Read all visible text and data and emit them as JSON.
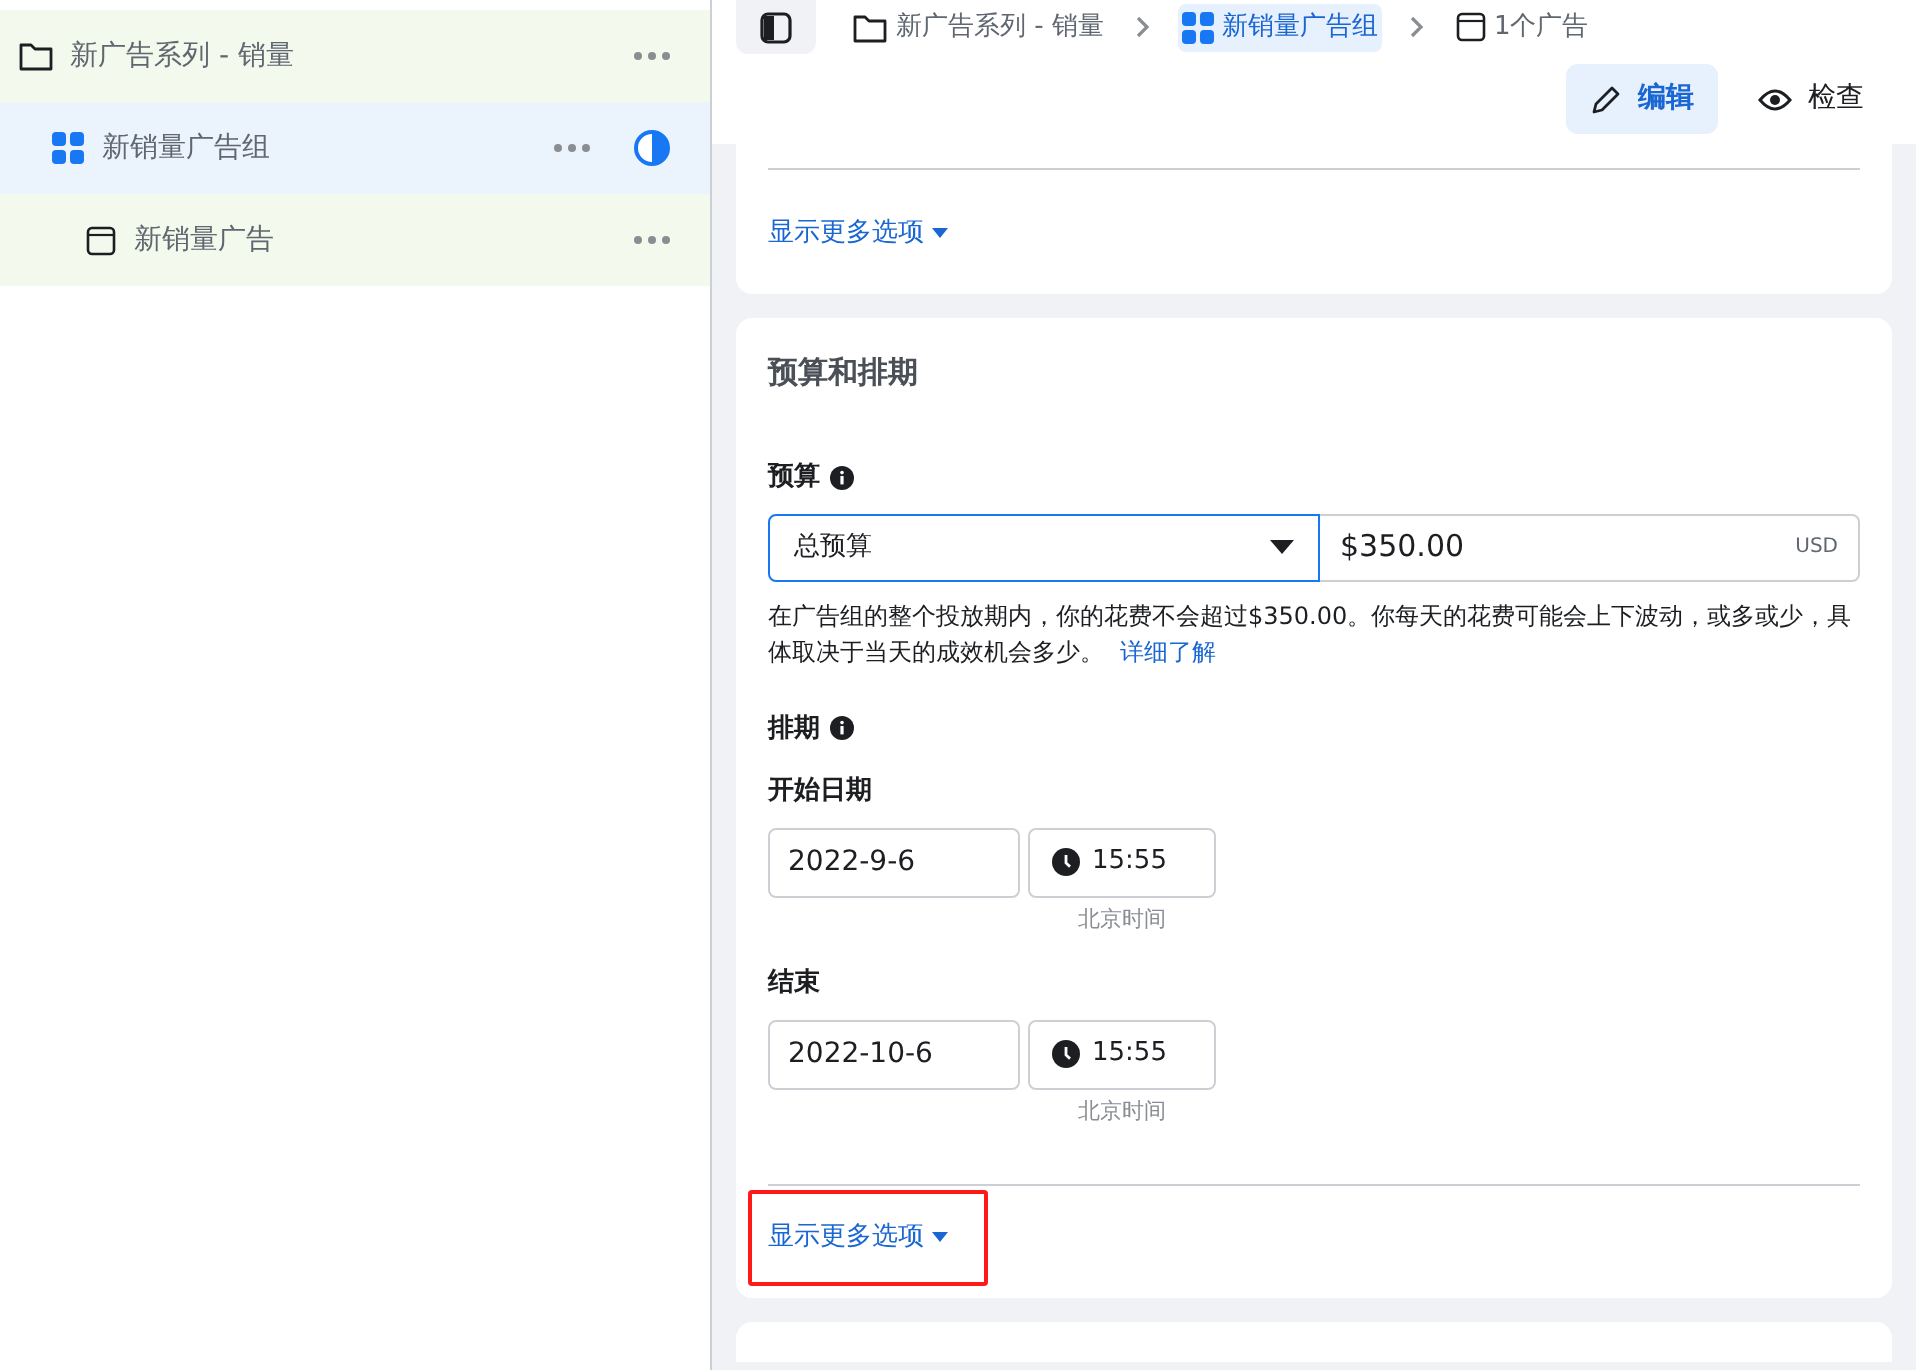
{
  "sidebar": {
    "items": [
      {
        "kind": "campaign",
        "label": "新广告系列 - 销量",
        "selected": false,
        "status": false,
        "children": [
          {
            "kind": "adset",
            "label": "新销量广告组",
            "selected": true,
            "status": true,
            "children": [
              {
                "kind": "ad",
                "label": "新销量广告",
                "selected": false,
                "status": false
              }
            ]
          }
        ]
      }
    ]
  },
  "breadcrumb": [
    {
      "kind": "campaign",
      "label": "新广告系列 - 销量",
      "selected": false
    },
    {
      "kind": "adset",
      "label": "新销量广告组",
      "selected": true
    },
    {
      "kind": "ad",
      "label": "1个广告",
      "selected": false
    }
  ],
  "mode_buttons": [
    {
      "kind": "edit",
      "label": "编辑",
      "selected": true
    },
    {
      "kind": "view",
      "label": "检查",
      "selected": false
    }
  ],
  "top_card": {
    "show_more": {
      "label": "显示更多选项",
      "annotated": false
    }
  },
  "budget_card": {
    "title": "预算和排期",
    "budget": {
      "label": "预算",
      "type_value": "总预算",
      "amount": "$350.00",
      "currency": "USD",
      "note": "在广告组的整个投放期内，你的花费不会超过$350.00。你每天的花费可能会上下波动，或多或少，具体取决于当天的成效机会多少。",
      "link": "详细了解"
    },
    "schedule": {
      "label": "排期",
      "rows": [
        {
          "label": "开始日期",
          "date": "2022-9-6",
          "time": "15:55",
          "timezone": "北京时间"
        },
        {
          "label": "结束",
          "date": "2022-10-6",
          "time": "15:55",
          "timezone": "北京时间"
        }
      ]
    },
    "show_more": {
      "label": "显示更多选项",
      "annotated": true
    }
  }
}
